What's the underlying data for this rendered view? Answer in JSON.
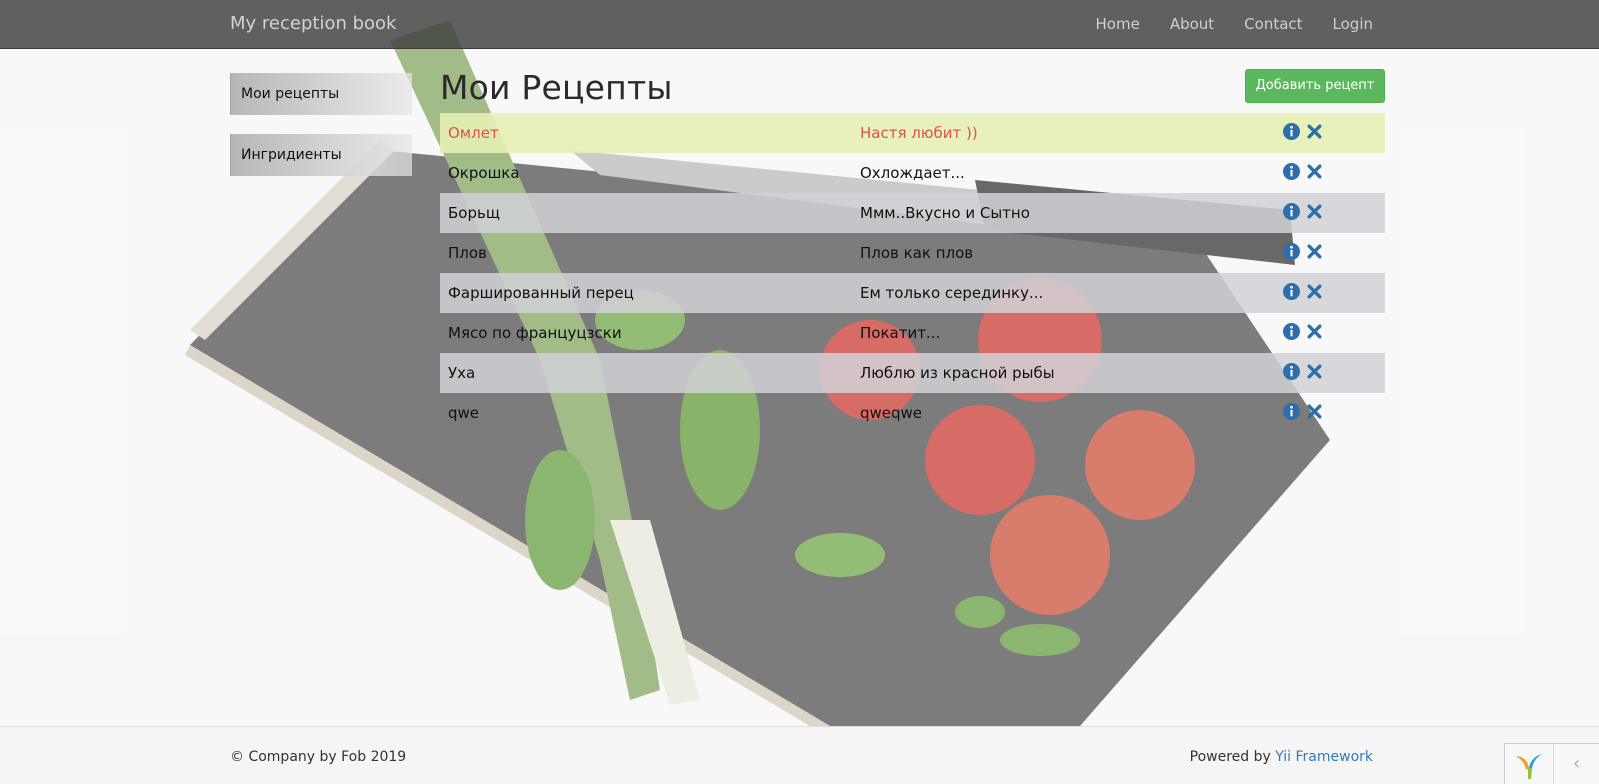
{
  "navbar": {
    "brand": "My reception book",
    "links": [
      "Home",
      "About",
      "Contact",
      "Login"
    ]
  },
  "sidebar": {
    "items": [
      "Мои рецепты",
      "Ингридиенты"
    ]
  },
  "main": {
    "title": "Мои Рецепты",
    "add_button": "Добавить рецепт",
    "rows": [
      {
        "name": "Омлет",
        "desc": "Настя любит ))"
      },
      {
        "name": "Окрошка",
        "desc": "Охлождает..."
      },
      {
        "name": "Борьщ",
        "desc": "Ммм..Вкусно и Сытно"
      },
      {
        "name": "Плов",
        "desc": "Плов как плов"
      },
      {
        "name": "Фаршированный перец",
        "desc": "Ем только серединку..."
      },
      {
        "name": "Мясо по француцзски",
        "desc": "Покатит..."
      },
      {
        "name": "Уха",
        "desc": "Люблю из красной рыбы"
      },
      {
        "name": "qwe",
        "desc": "qweqwe"
      }
    ]
  },
  "footer": {
    "copyright": "© Company by Fob 2019",
    "powered_prefix": "Powered by ",
    "powered_link": "Yii Framework"
  },
  "icons": {
    "info": "info-circle-icon",
    "delete": "close-icon",
    "debug_toggle": "chevron-left-icon"
  },
  "colors": {
    "navbar": "#4b4b4b",
    "add_button": "#5cb85c",
    "highlight_row": "#e6eeb4",
    "highlight_text": "#d9534f",
    "icon_blue": "#2c6fad",
    "link": "#337ab7"
  }
}
